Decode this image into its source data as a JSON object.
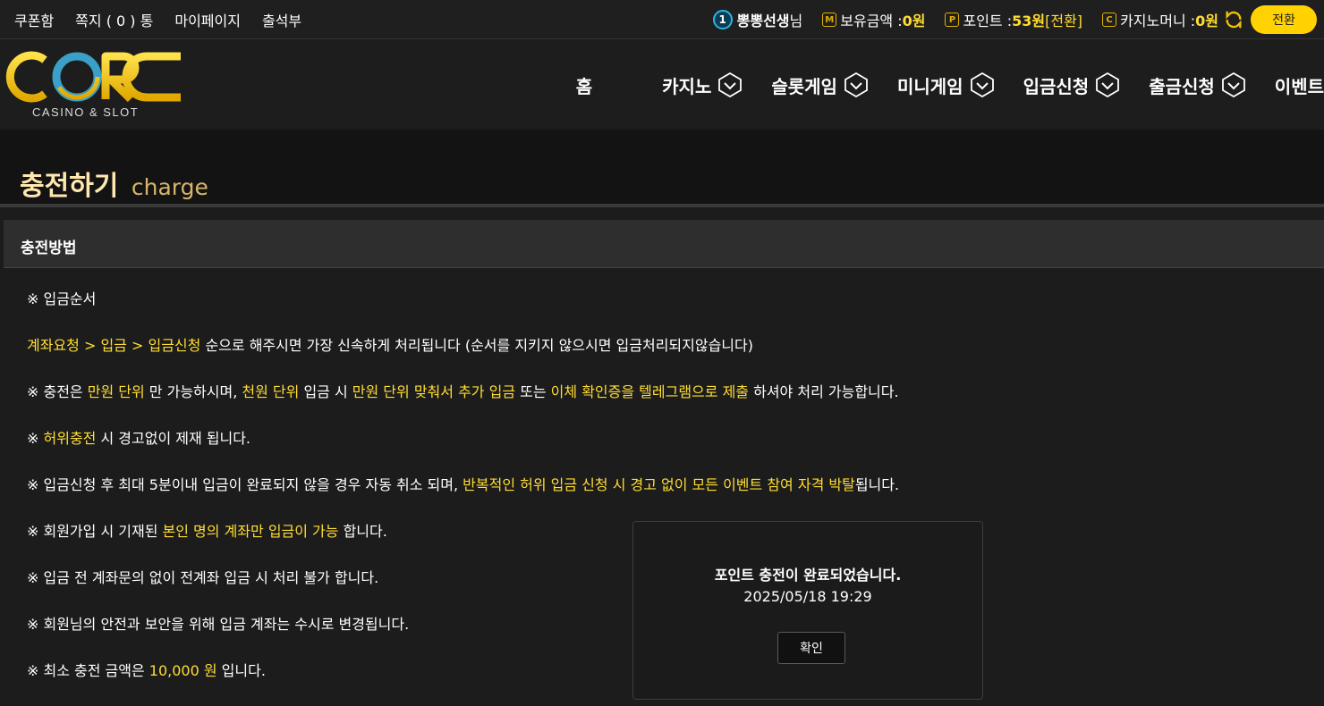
{
  "topbar": {
    "links": [
      "쿠폰함",
      "쪽지 ( 0 ) 통",
      "마이페이지",
      "출석부"
    ],
    "user": {
      "level": "1",
      "name": "뽕뽕선생",
      "suffix": "님"
    },
    "balance": {
      "icon": "M",
      "label": "보유금액 : ",
      "value": "0원"
    },
    "points": {
      "icon": "P",
      "label": "포인트 : ",
      "value": "53원",
      "action": " [전환]"
    },
    "casino_money": {
      "icon": "C",
      "label": "카지노머니 : ",
      "value": "0원"
    },
    "convert_button": "전환"
  },
  "logo": {
    "text": "CORE",
    "subtitle": "CASINO & SLOT"
  },
  "nav": {
    "items": [
      "홈",
      "카지노",
      "슬롯게임",
      "미니게임",
      "입금신청",
      "출금신청",
      "이벤트"
    ]
  },
  "page": {
    "title": "충전하기",
    "title_sub": "charge"
  },
  "panel": {
    "heading": "충전방법",
    "lines": [
      [
        {
          "t": "※ 입금순서",
          "h": false
        }
      ],
      [
        {
          "t": "계좌요청 > 입금 > 입금신청",
          "h": true
        },
        {
          "t": " 순으로 해주시면 가장 신속하게 처리됩니다 (순서를 지키지 않으시면 입금처리되지않습니다)",
          "h": false
        }
      ],
      [
        {
          "t": "※ 충전은 ",
          "h": false
        },
        {
          "t": "만원 단위",
          "h": true
        },
        {
          "t": " 만 가능하시며, ",
          "h": false
        },
        {
          "t": "천원 단위",
          "h": true
        },
        {
          "t": " 입금 시 ",
          "h": false
        },
        {
          "t": "만원 단위 맞춰서 추가 입금",
          "h": true
        },
        {
          "t": " 또는 ",
          "h": false
        },
        {
          "t": "이체 확인증을 텔레그램으로 제출",
          "h": true
        },
        {
          "t": " 하셔야 처리 가능합니다.",
          "h": false
        }
      ],
      [
        {
          "t": "※ ",
          "h": false
        },
        {
          "t": "허위충전",
          "h": true
        },
        {
          "t": " 시 경고없이 제재 됩니다.",
          "h": false
        }
      ],
      [
        {
          "t": "※ 입금신청 후 최대 5분이내 입금이 완료되지 않을 경우 자동 취소 되며, ",
          "h": false
        },
        {
          "t": "반복적인 허위 입금 신청 시 경고 없이 모든 이벤트 참여 자격 박탈",
          "h": true
        },
        {
          "t": "됩니다.",
          "h": false
        }
      ],
      [
        {
          "t": "※ 회원가입 시 기재된 ",
          "h": false
        },
        {
          "t": "본인 명의 계좌만 입금이 가능",
          "h": true
        },
        {
          "t": " 합니다.",
          "h": false
        }
      ],
      [
        {
          "t": "※ 입금 전 계좌문의 없이 전계좌 입금 시 처리 불가 합니다.",
          "h": false
        }
      ],
      [
        {
          "t": "※ 회원님의 안전과 보안을 위해 입금 계좌는 수시로 변경됩니다.",
          "h": false
        }
      ],
      [
        {
          "t": "※ 최소 충전 금액은 ",
          "h": false
        },
        {
          "t": "10,000 원",
          "h": true
        },
        {
          "t": " 입니다.",
          "h": false
        }
      ]
    ]
  },
  "modal": {
    "message": "포인트 충전이 완료되었습니다.",
    "timestamp": "2025/05/18 19:29",
    "confirm_button": "확인"
  },
  "colors": {
    "accent": "#ffd200",
    "highlight_text": "#ffdd33",
    "level_badge": "#2bb5e0"
  }
}
